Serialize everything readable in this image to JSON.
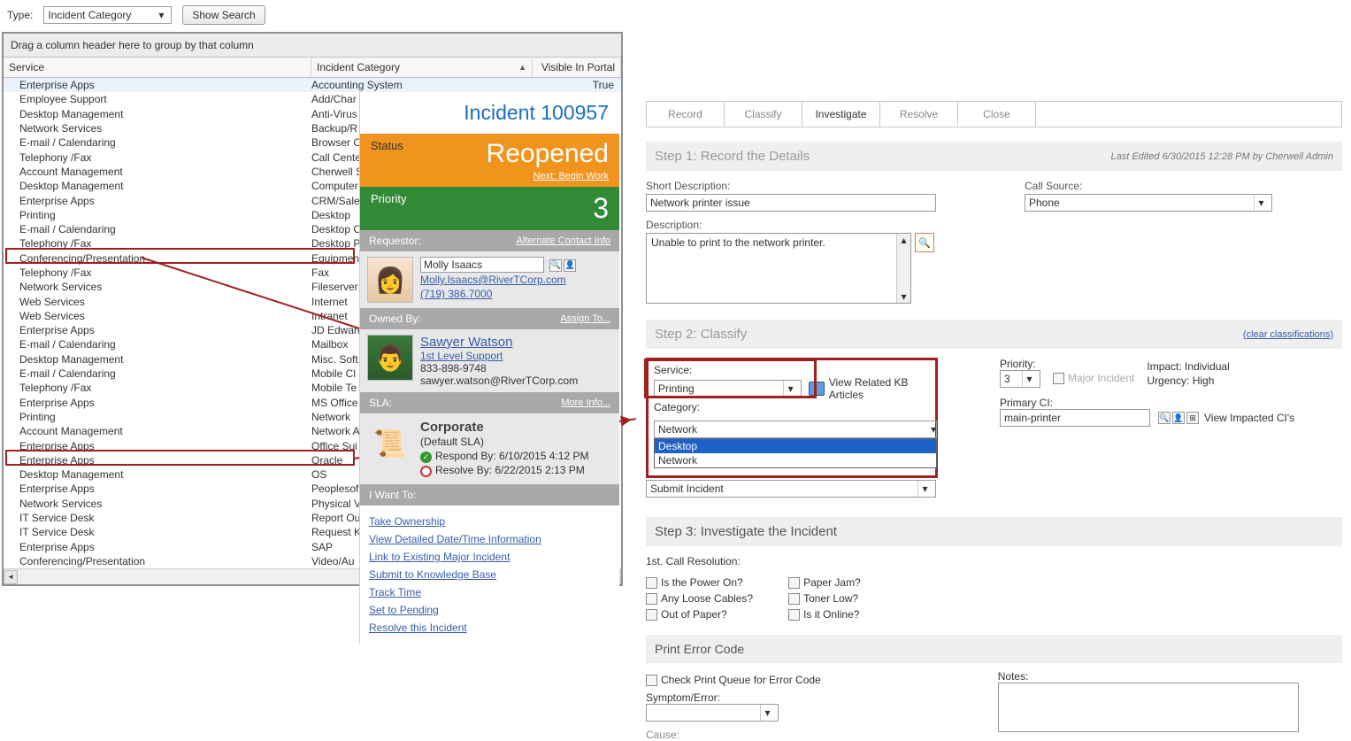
{
  "topbar": {
    "type_label": "Type:",
    "type_value": "Incident Category",
    "show_search": "Show Search"
  },
  "grid": {
    "group_hint": "Drag a column header here to group by that column",
    "headers": {
      "service": "Service",
      "category": "Incident Category",
      "visible": "Visible In Portal"
    },
    "rows": [
      {
        "s": "Enterprise Apps",
        "c": "Accounting System",
        "v": "True"
      },
      {
        "s": "Employee Support",
        "c": "Add/Char"
      },
      {
        "s": "Desktop Management",
        "c": "Anti-Virus"
      },
      {
        "s": "Network Services",
        "c": "Backup/R"
      },
      {
        "s": "E-mail / Calendaring",
        "c": "Browser C"
      },
      {
        "s": "Telephony /Fax",
        "c": "Call Cente"
      },
      {
        "s": "Account Management",
        "c": "Cherwell S"
      },
      {
        "s": "Desktop Management",
        "c": "Computer"
      },
      {
        "s": "Enterprise Apps",
        "c": "CRM/Sale"
      },
      {
        "s": "Printing",
        "c": "Desktop"
      },
      {
        "s": "E-mail / Calendaring",
        "c": "Desktop C"
      },
      {
        "s": "Telephony /Fax",
        "c": "Desktop P"
      },
      {
        "s": "Conferencing/Presentation",
        "c": "Equipmen"
      },
      {
        "s": "Telephony /Fax",
        "c": "Fax"
      },
      {
        "s": "Network Services",
        "c": "Fileserver"
      },
      {
        "s": "Web Services",
        "c": "Internet"
      },
      {
        "s": "Web Services",
        "c": "Intranet"
      },
      {
        "s": "Enterprise Apps",
        "c": "JD Edward"
      },
      {
        "s": "E-mail / Calendaring",
        "c": "Mailbox"
      },
      {
        "s": "Desktop Management",
        "c": "Misc. Soft"
      },
      {
        "s": "E-mail / Calendaring",
        "c": "Mobile Cl"
      },
      {
        "s": "Telephony /Fax",
        "c": "Mobile Te"
      },
      {
        "s": "Enterprise Apps",
        "c": "MS Office"
      },
      {
        "s": "Printing",
        "c": "Network"
      },
      {
        "s": "Account Management",
        "c": "Network A"
      },
      {
        "s": "Enterprise Apps",
        "c": "Office Sui"
      },
      {
        "s": "Enterprise Apps",
        "c": "Oracle"
      },
      {
        "s": "Desktop Management",
        "c": "OS"
      },
      {
        "s": "Enterprise Apps",
        "c": "Peoplesof"
      },
      {
        "s": "Network Services",
        "c": "Physical V"
      },
      {
        "s": "IT Service Desk",
        "c": "Report Ou"
      },
      {
        "s": "IT Service Desk",
        "c": "Request K"
      },
      {
        "s": "Enterprise Apps",
        "c": "SAP"
      },
      {
        "s": "Conferencing/Presentation",
        "c": "Video/Au"
      }
    ]
  },
  "incident": {
    "title": "Incident 100957",
    "status_label": "Status",
    "status_value": "Reopened",
    "next_action": "Next: Begin Work",
    "priority_label": "Priority",
    "priority_value": "3",
    "requestor_label": "Requestor:",
    "alt_contact": "Alternate Contact Info",
    "requestor": {
      "name": "Molly Isaacs",
      "email": "Molly.Isaacs@RiverTCorp.com",
      "phone": "(719) 386.7000"
    },
    "owned_label": "Owned By:",
    "assign_to": "Assign To...",
    "owner": {
      "name": "Sawyer Watson",
      "group": "1st Level Support",
      "phone": "833-898-9748",
      "email": "sawyer.watson@RiverTCorp.com"
    },
    "sla_label": "SLA:",
    "more_info": "More Info...",
    "sla": {
      "title": "Corporate",
      "subtitle": "(Default SLA)",
      "respond": "Respond By: 6/10/2015 4:12 PM",
      "resolve": "Resolve By: 6/22/2015 2:13 PM"
    },
    "want_label": "I Want To:",
    "wants": [
      "Take Ownership",
      "View Detailed Date/Time Information",
      "Link to Existing Major Incident",
      "Submit to Knowledge Base",
      "Track Time",
      "Set to Pending",
      "Resolve this Incident"
    ]
  },
  "form": {
    "tabs": [
      "Record",
      "Classify",
      "Investigate",
      "Resolve",
      "Close"
    ],
    "step1": {
      "title": "Step 1:  Record the Details",
      "edited": "Last Edited 6/30/2015 12:28 PM by Cherwell Admin",
      "short_label": "Short Description:",
      "short_value": "Network printer issue",
      "desc_label": "Description:",
      "desc_value": "Unable to print to the network printer.",
      "call_label": "Call Source:",
      "call_value": "Phone"
    },
    "step2": {
      "title": "Step 2:  Classify",
      "clear": "(clear classifications)",
      "service_label": "Service:",
      "service_value": "Printing",
      "kb": "View Related KB Articles",
      "category_label": "Category:",
      "category_value": "Network",
      "options_desktop": "Desktop",
      "options_network": "Network",
      "submit": "Submit Incident",
      "priority_label": "Priority:",
      "priority_value": "3",
      "major": "Major Incident",
      "impact": "Impact: Individual",
      "urgency": "Urgency: High",
      "primary_label": "Primary CI:",
      "primary_value": "main-printer",
      "view_ci": "View Impacted CI's"
    },
    "step3": {
      "title": "Step 3:  Investigate the Incident",
      "first_call": "1st. Call Resolution:",
      "checks_left": [
        "Is the Power On?",
        "Any Loose Cables?",
        "Out of Paper?"
      ],
      "checks_right": [
        "Paper Jam?",
        "Toner Low?",
        "Is it Online?"
      ],
      "err_head": "Print Error Code",
      "err_check": "Check Print Queue for Error Code",
      "symptom": "Symptom/Error:",
      "cause": "Cause:",
      "notes": "Notes:"
    }
  }
}
